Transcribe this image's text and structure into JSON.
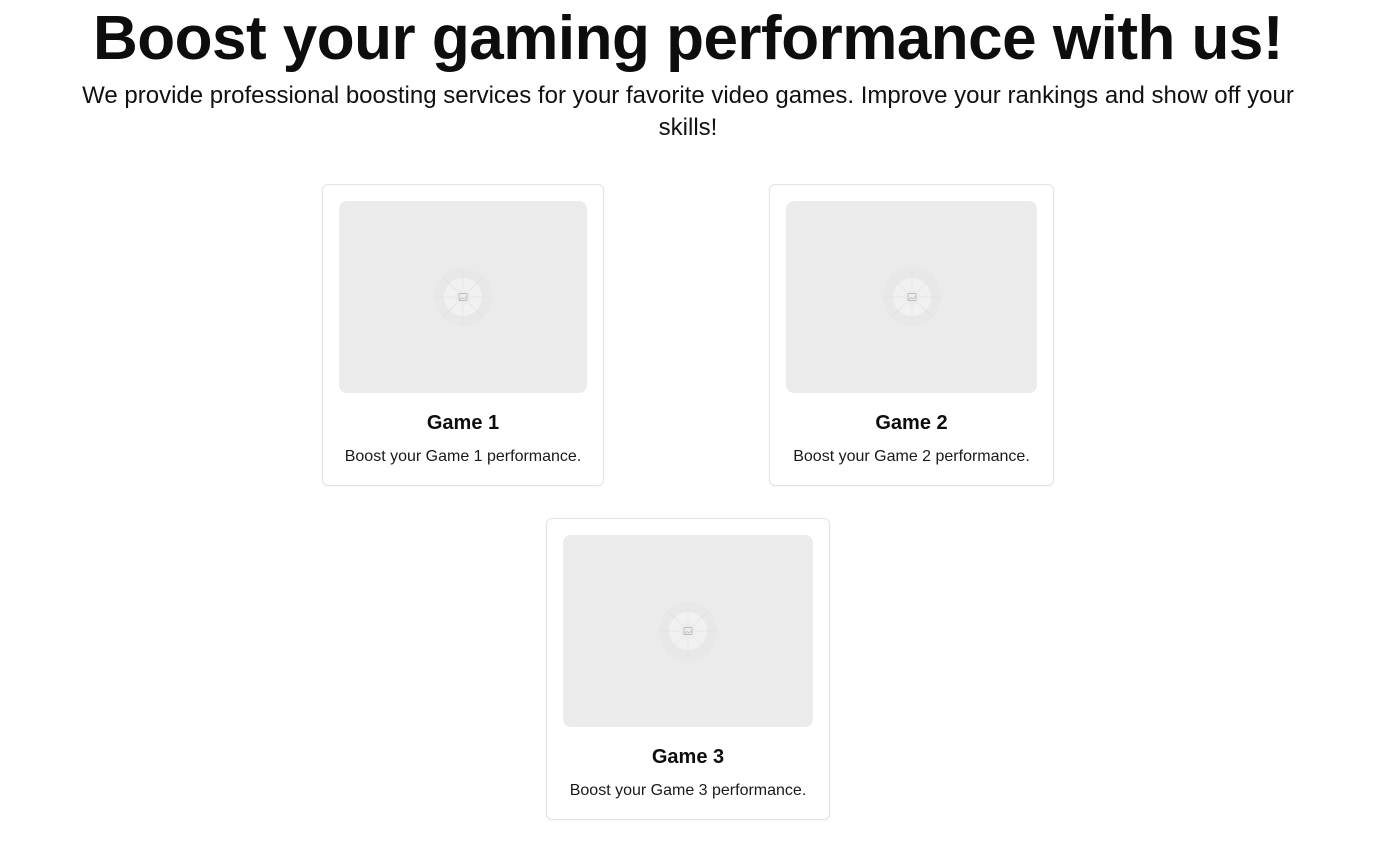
{
  "hero": {
    "title": "Boost your gaming performance with us!",
    "subtitle": "We provide professional boosting services for your favorite video games. Improve your rankings and show off your skills!"
  },
  "games": [
    {
      "title": "Game 1",
      "description": "Boost your Game 1 performance.",
      "image_icon": "image-placeholder-icon"
    },
    {
      "title": "Game 2",
      "description": "Boost your Game 2 performance.",
      "image_icon": "image-placeholder-icon"
    },
    {
      "title": "Game 3",
      "description": "Boost your Game 3 performance.",
      "image_icon": "image-placeholder-icon"
    }
  ],
  "colors": {
    "background": "#ffffff",
    "text": "#0d0d0d",
    "card_border": "#e3e3e3",
    "image_placeholder": "#ebebeb"
  }
}
